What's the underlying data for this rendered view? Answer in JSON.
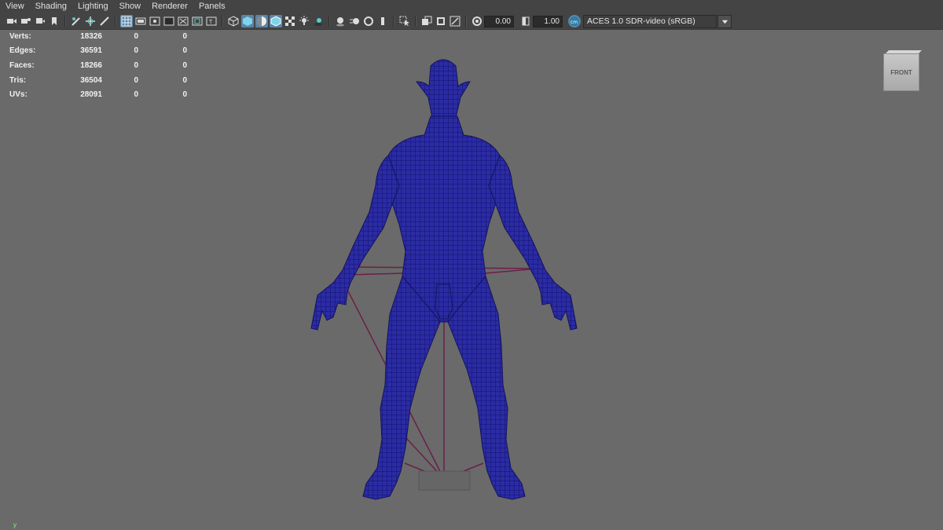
{
  "menu": [
    "View",
    "Shading",
    "Lighting",
    "Show",
    "Renderer",
    "Panels"
  ],
  "toolbar": {
    "exposure_value": "0.00",
    "gamma_value": "1.00",
    "color_space": "ACES 1.0 SDR-video (sRGB)"
  },
  "hud": {
    "rows": [
      {
        "label": "Verts:",
        "v1": "18326",
        "v2": "0",
        "v3": "0"
      },
      {
        "label": "Edges:",
        "v1": "36591",
        "v2": "0",
        "v3": "0"
      },
      {
        "label": "Faces:",
        "v1": "18266",
        "v2": "0",
        "v3": "0"
      },
      {
        "label": "Tris:",
        "v1": "36504",
        "v2": "0",
        "v3": "0"
      },
      {
        "label": "UVs:",
        "v1": "28091",
        "v2": "0",
        "v3": "0"
      }
    ]
  },
  "viewcube": {
    "face": "FRONT"
  },
  "axis": {
    "label": "y"
  },
  "colors": {
    "viewport_bg": "#6a6a6a",
    "wireframe": "#1f1f8f",
    "mesh_fill": "#2a2aa0",
    "rig_lines": "#6b1f4a"
  }
}
